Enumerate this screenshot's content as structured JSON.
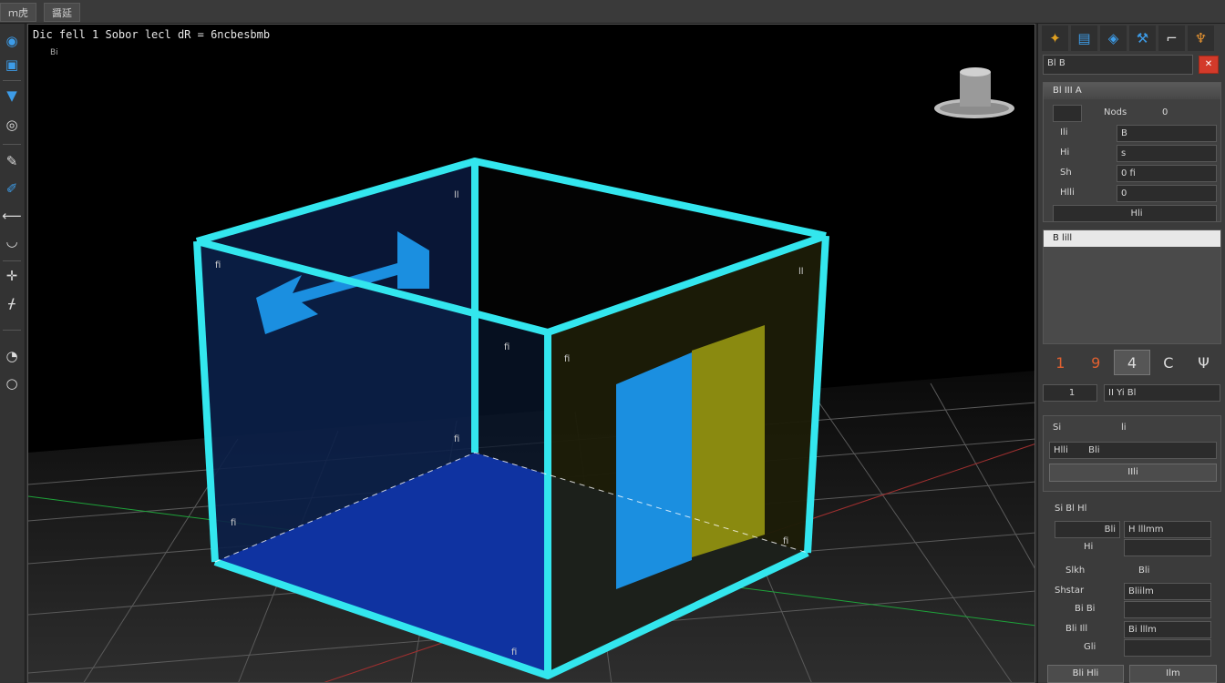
{
  "tabs": [
    {
      "label": "ｍ虎"
    },
    {
      "label": "醤延"
    }
  ],
  "viewport": {
    "label": "Dic fell 1 Sobor lecl dR = 6ncbesbmb",
    "sub_label": "Bi",
    "box_labels": [
      "ll",
      "fi",
      "ll",
      "fi",
      "fi",
      "fi",
      "fi",
      "fi",
      "fi"
    ]
  },
  "left_tools": [
    {
      "icon": "globe-icon"
    },
    {
      "icon": "select-icon"
    },
    {
      "icon": "funnel-icon"
    },
    {
      "icon": "orbit-icon"
    },
    {
      "icon": "pen-icon"
    },
    {
      "icon": "brush-icon"
    },
    {
      "icon": "line-icon"
    },
    {
      "icon": "cup-icon"
    },
    {
      "icon": "pin-icon"
    },
    {
      "icon": "tool-icon"
    },
    {
      "icon": "eye-icon"
    },
    {
      "icon": "circle-icon"
    }
  ],
  "right_panel": {
    "top_icons": [
      "paint-icon",
      "flag-icon",
      "shield-icon",
      "wrench-icon",
      "frame-icon",
      "lamp-icon"
    ],
    "second_bar": {
      "label": "Bl  B",
      "close_label": "✕"
    },
    "props_header": "Bl III A",
    "props": [
      {
        "label": "Nods",
        "value": "0"
      },
      {
        "label": "Ili",
        "value": "B"
      },
      {
        "label": "Hi",
        "value": "s"
      },
      {
        "label": "Sh",
        "value": "0 fi"
      },
      {
        "label": "Hlli",
        "value": "0"
      },
      {
        "label": "Hli",
        "value": ""
      }
    ],
    "list_header": "B lill",
    "tool_row": [
      "1",
      "9",
      "4",
      "C",
      "Ψ"
    ],
    "dropdown": {
      "left": "1",
      "right": "II Yi Bl"
    },
    "settings": [
      {
        "label": "Si",
        "value": "li"
      },
      {
        "label": "Hlli",
        "value": "Bli"
      }
    ],
    "settings_button": "IIli",
    "fields_header": "Si Bl Hl",
    "fields": [
      {
        "label": "Bli",
        "value": "H lllmm"
      },
      {
        "label": "Hi",
        "value": ""
      },
      {
        "label": "Slkh",
        "value": "Bli"
      },
      {
        "label": "Shstar",
        "value": "Bliilm"
      },
      {
        "label": "Bi Bi",
        "value": ""
      },
      {
        "label": "Bli Ill",
        "value": "Bi lllm"
      },
      {
        "label": "Gli",
        "value": ""
      }
    ],
    "bottom_buttons": [
      "Bli Hli",
      "Ilm"
    ]
  },
  "colors": {
    "box_edge": "#33e6ee",
    "floor_blue": "#1038c8",
    "panel_blue": "#1b8fe0",
    "panel_yellow": "#8a8a10",
    "grid_line": "#5a5a5a",
    "accent_red": "#d33a2a"
  }
}
